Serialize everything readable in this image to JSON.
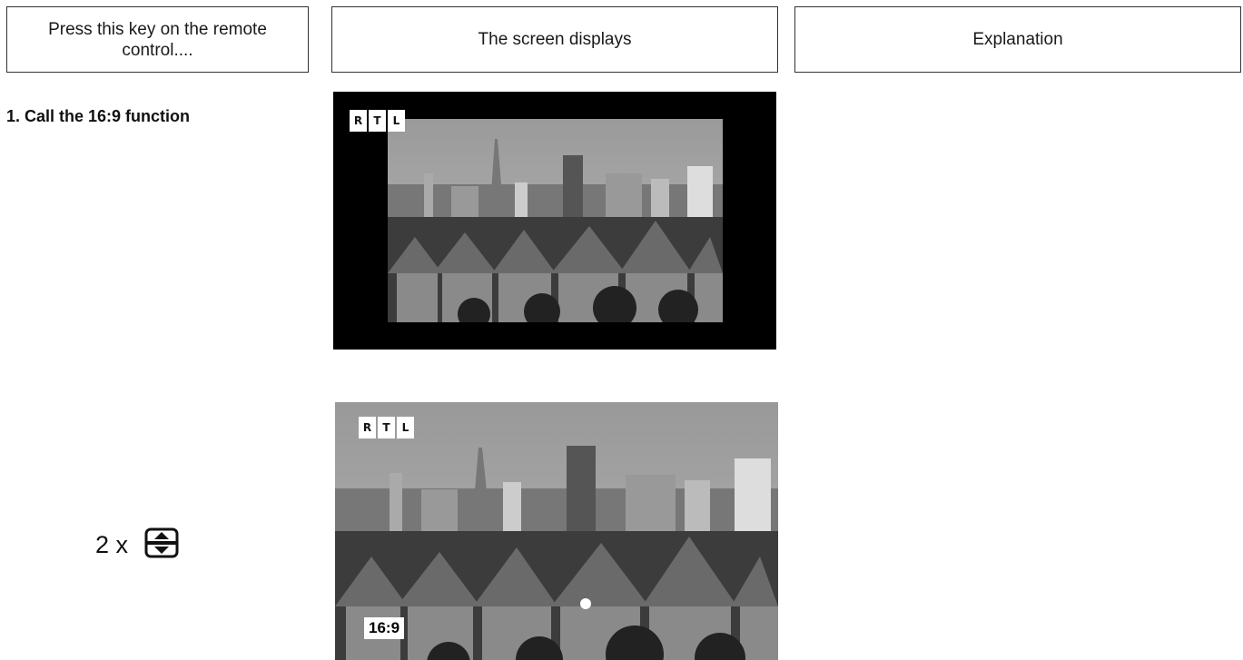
{
  "table_header": {
    "col1": "Press this key on the remote control....",
    "col2": "The screen displays",
    "col3": "Explanation"
  },
  "step": {
    "title": "1. Call the 16:9 function",
    "key_press_count": "2 x",
    "key_icon": "zoom-format-icon"
  },
  "screens": [
    {
      "logo": [
        "R",
        "T",
        "L"
      ],
      "mode": "letterbox"
    },
    {
      "logo": [
        "R",
        "T",
        "L"
      ],
      "mode": "fullscreen",
      "badge": "16:9"
    }
  ],
  "colors": {
    "border": "#333333",
    "screen_background": "#000000"
  }
}
